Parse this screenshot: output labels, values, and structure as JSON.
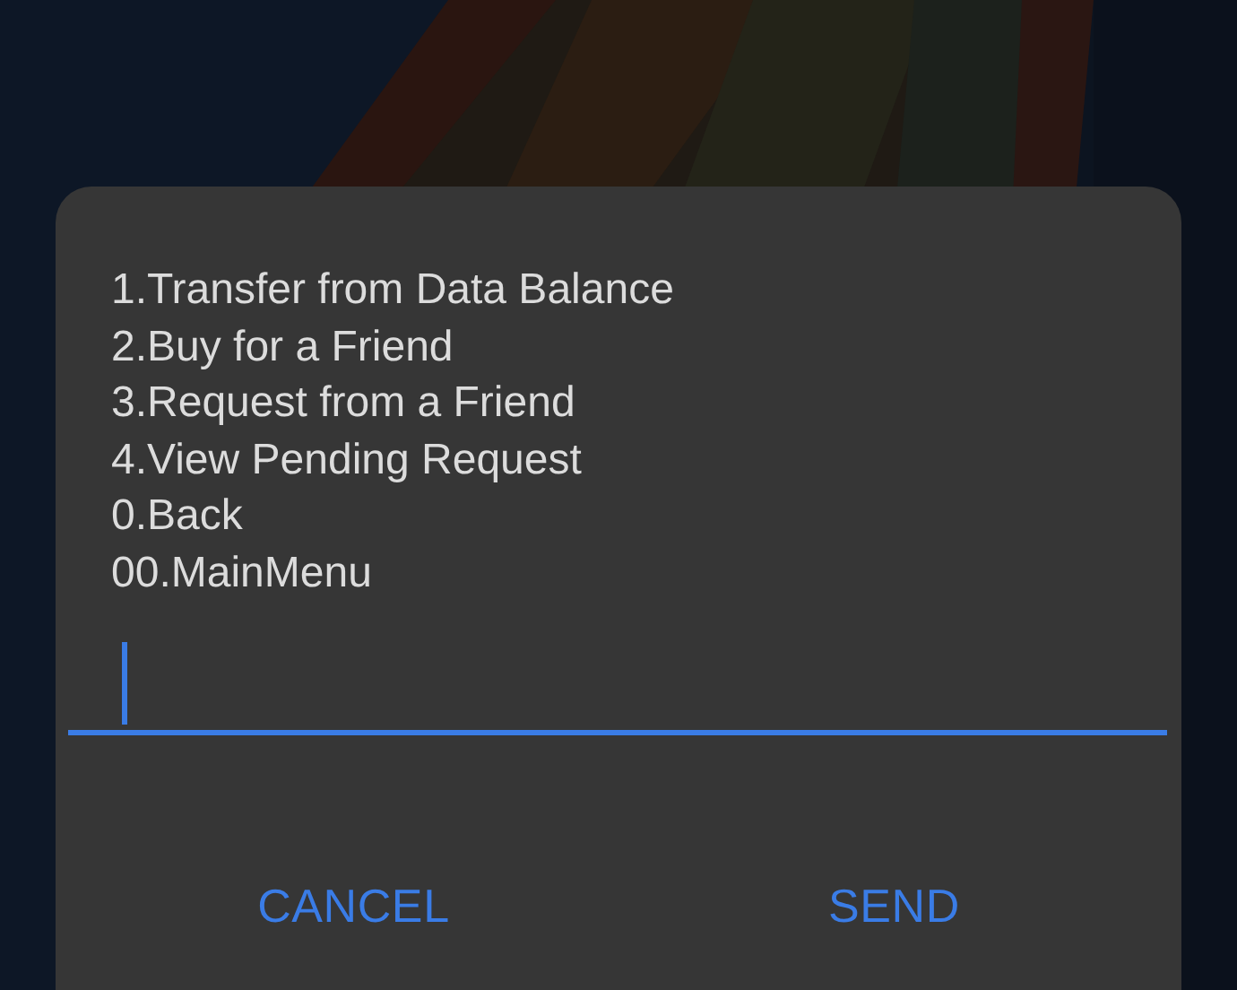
{
  "dialog": {
    "lines": [
      "1.Transfer from Data Balance",
      "2.Buy for a Friend",
      "3.Request from a Friend",
      "4.View Pending Request",
      "0.Back",
      "00.MainMenu"
    ],
    "input": {
      "focused": true
    },
    "buttons": [
      {
        "label": "CANCEL"
      },
      {
        "label": "SEND"
      }
    ]
  }
}
